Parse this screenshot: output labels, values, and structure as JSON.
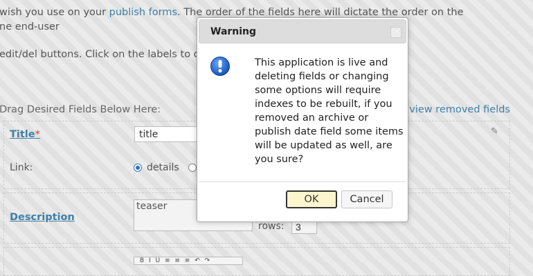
{
  "background": {
    "intro_line1_before": "wish you use on your ",
    "intro_link": "publish forms",
    "intro_line1_after": ". The order of the fields here will dictate the order on the",
    "intro_line2": "ne end-user",
    "intro_line3": "edit/del buttons. Click on the labels to d",
    "drag_label": "Drag Desired Fields Below Here:",
    "view_removed_link": "view removed fields",
    "fields": {
      "title_label": "Title",
      "required_marker": "*",
      "title_value": "title",
      "link_label": "Link:",
      "link_option": "details",
      "description_label": "Description",
      "description_value": "teaser",
      "rows_label": "rows:",
      "rows_value": "3"
    }
  },
  "dialog": {
    "title": "Warning",
    "message": "This application is live and deleting fields or changing some options will require indexes to be rebuilt, if you removed an archive or publish date field some items will be updated as well, are you sure?",
    "ok_label": "OK",
    "cancel_label": "Cancel",
    "icon": "info-icon",
    "accent_color": "#2f6fc0"
  }
}
